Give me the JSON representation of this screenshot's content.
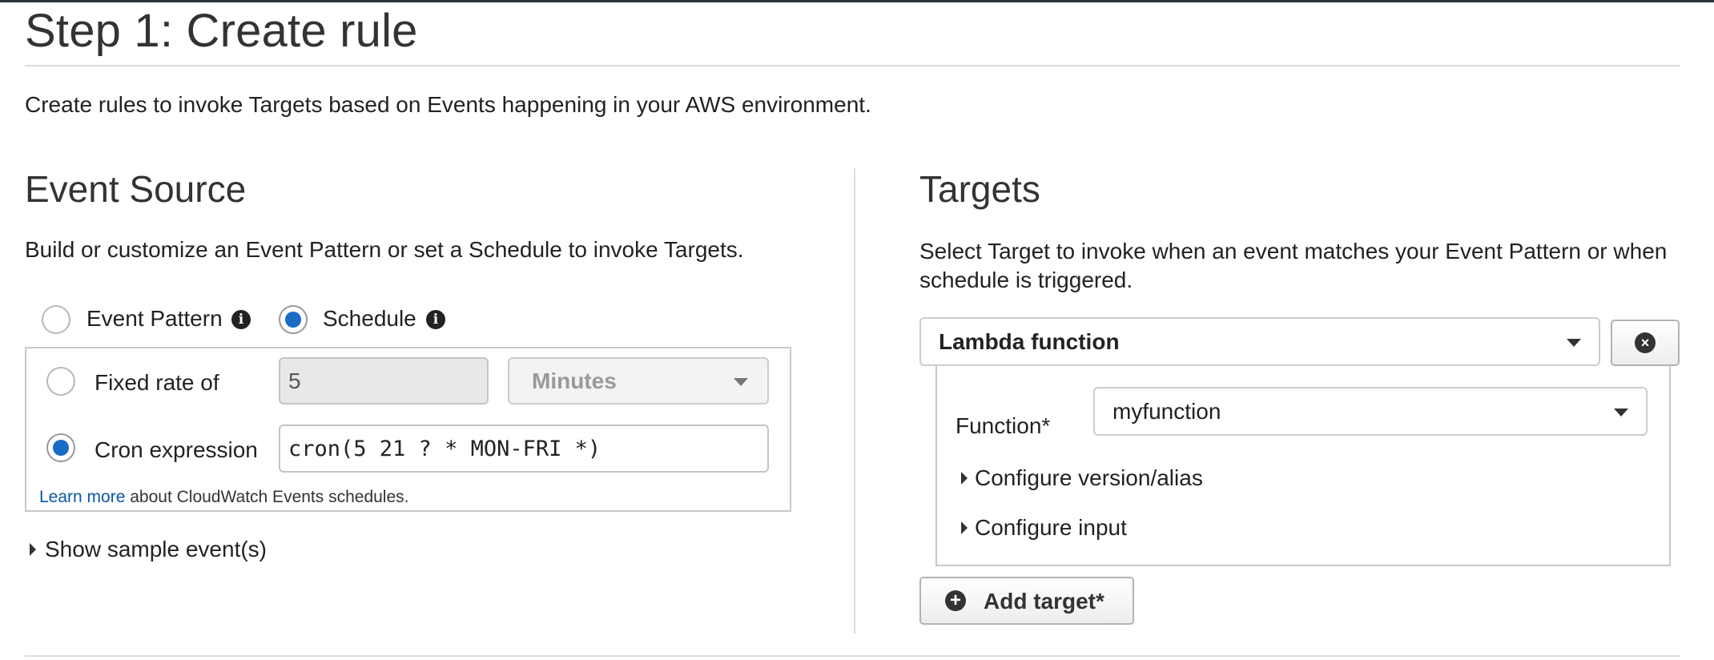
{
  "page": {
    "title": "Step 1: Create rule",
    "description": "Create rules to invoke Targets based on Events happening in your AWS environment."
  },
  "event_source": {
    "heading": "Event Source",
    "description": "Build or customize an Event Pattern or set a Schedule to invoke Targets.",
    "mode_options": [
      {
        "label": "Event Pattern",
        "selected": false
      },
      {
        "label": "Schedule",
        "selected": true
      }
    ],
    "schedule": {
      "fixed_rate_label": "Fixed rate of",
      "fixed_rate_value": "5",
      "fixed_rate_unit": "Minutes",
      "fixed_rate_selected": false,
      "cron_label": "Cron expression",
      "cron_value": "cron(5 21 ? * MON-FRI *)",
      "cron_selected": true,
      "learn_more_link": "Learn more",
      "learn_more_suffix": "about CloudWatch Events schedules."
    },
    "show_sample_events": "Show sample event(s)"
  },
  "targets": {
    "heading": "Targets",
    "description": "Select Target to invoke when an event matches your Event Pattern or when schedule is triggered.",
    "target_type": "Lambda function",
    "function_label": "Function*",
    "function_value": "myfunction",
    "configure_version": "Configure version/alias",
    "configure_input": "Configure input",
    "add_target": "Add target*"
  },
  "icons": {
    "info": "info-circle-icon",
    "remove": "close-circle-icon",
    "add": "plus-circle-icon",
    "dropdown": "caret-down-icon",
    "expand": "caret-right-icon"
  },
  "colors": {
    "radio_selected": "#1a6bc4",
    "link": "#0a57a8"
  }
}
